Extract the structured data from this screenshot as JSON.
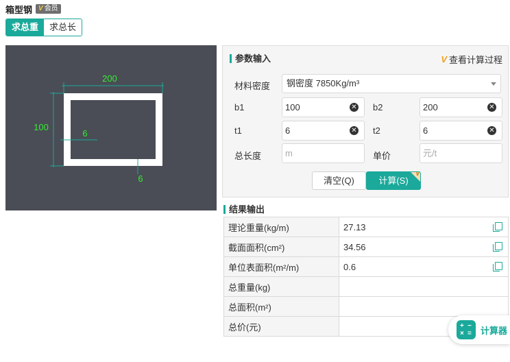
{
  "header": {
    "title": "箱型钢",
    "vip_mark": "V",
    "vip_label": "会员"
  },
  "tabs": [
    {
      "label": "求总重",
      "active": true
    },
    {
      "label": "求总长",
      "active": false
    }
  ],
  "diagram": {
    "dim_top": "200",
    "dim_left": "100",
    "dim_inner": "6",
    "dim_bottom": "6",
    "colors": {
      "background": "#4a4d55",
      "profile": "#ffffff",
      "dimension": "#1aa99a",
      "dimension_text": "#33ee33"
    }
  },
  "params": {
    "section_title": "参数输入",
    "calc_process_mark": "V",
    "calc_process_label": "查看计算过程",
    "density_label": "材料密度",
    "density_value": "钢密度 7850Kg/m³",
    "fields": {
      "b1": {
        "label": "b1",
        "value": "100"
      },
      "b2": {
        "label": "b2",
        "value": "200"
      },
      "t1": {
        "label": "t1",
        "value": "6"
      },
      "t2": {
        "label": "t2",
        "value": "6"
      }
    },
    "length_label": "总长度",
    "length_placeholder": "m",
    "price_label": "单价",
    "price_placeholder": "元/t",
    "clear_button": "清空(Q)",
    "calc_button": "计算(S)",
    "calc_button_corner": "V"
  },
  "results": {
    "section_title": "结果输出",
    "rows": [
      {
        "name": "理论重量(kg/m)",
        "value": "27.13",
        "copyable": true
      },
      {
        "name": "截面面积(cm²)",
        "value": "34.56",
        "copyable": true
      },
      {
        "name": "单位表面积(m²/m)",
        "value": "0.6",
        "copyable": true
      },
      {
        "name": "总重量(kg)",
        "value": "",
        "copyable": false
      },
      {
        "name": "总面积(m²)",
        "value": "",
        "copyable": false
      },
      {
        "name": "总价(元)",
        "value": "",
        "copyable": false
      }
    ]
  },
  "floating": {
    "label": "计算器",
    "icon": "calculator-icon"
  },
  "colors": {
    "accent": "#1aa99a",
    "panel_bg": "#f5f5f5",
    "border": "#d9d9d9"
  }
}
